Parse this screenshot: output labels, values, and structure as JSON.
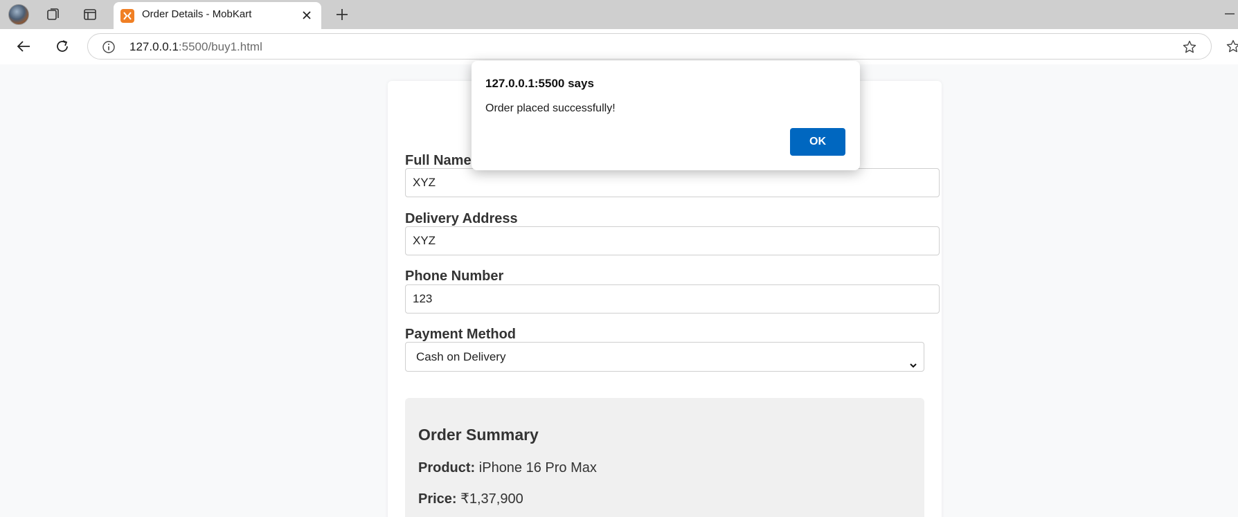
{
  "browser": {
    "tab_title": "Order Details - MobKart",
    "url_host": "127.0.0.1",
    "url_rest": ":5500/buy1.html",
    "favicon_color": "#f07f24"
  },
  "form": {
    "fields": [
      {
        "label": "Full Name",
        "value": "XYZ"
      },
      {
        "label": "Delivery Address",
        "value": "XYZ"
      },
      {
        "label": "Phone Number",
        "value": "123"
      }
    ],
    "payment": {
      "label": "Payment Method",
      "selected": "Cash on Delivery"
    }
  },
  "summary": {
    "title": "Order Summary",
    "product_label": "Product:",
    "product_value": "iPhone 16 Pro Max",
    "price_label": "Price:",
    "price_value": "₹1,37,900"
  },
  "dialog": {
    "title": "127.0.0.1:5500 says",
    "message": "Order placed successfully!",
    "ok_label": "OK",
    "ok_color": "#0067c0"
  }
}
